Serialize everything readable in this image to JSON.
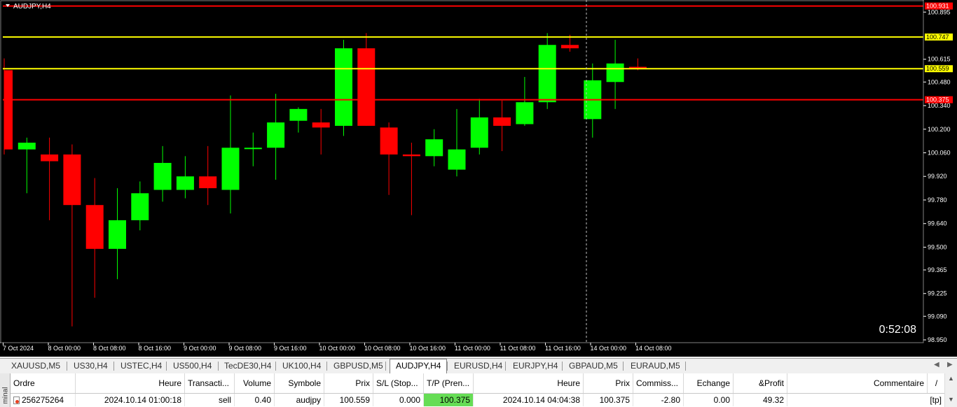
{
  "chart": {
    "title": "AUDJPY,H4",
    "timer": "0:52:08",
    "y_min": 98.95,
    "y_max": 100.95,
    "price_ticks": [
      "100.895",
      "100.615",
      "100.480",
      "100.340",
      "100.200",
      "100.060",
      "99.920",
      "99.780",
      "99.640",
      "99.500",
      "99.365",
      "99.225",
      "99.090",
      "98.950"
    ],
    "time_labels": [
      "7 Oct 2024",
      "8 Oct 00:00",
      "8 Oct 08:00",
      "8 Oct 16:00",
      "9 Oct 00:00",
      "9 Oct 08:00",
      "9 Oct 16:00",
      "10 Oct 00:00",
      "10 Oct 08:00",
      "10 Oct 16:00",
      "11 Oct 00:00",
      "11 Oct 08:00",
      "11 Oct 16:00",
      "14 Oct 00:00",
      "14 Oct 08:00"
    ],
    "hlines": [
      {
        "price": 100.931,
        "color": "#ff0000",
        "label": "100.931"
      },
      {
        "price": 100.747,
        "color": "#ffff00",
        "label": "100.747"
      },
      {
        "price": 100.559,
        "color": "#ffff00",
        "label": "100.559"
      },
      {
        "price": 100.375,
        "color": "#ff0000",
        "label": "100.375"
      }
    ],
    "bull_color": "#00ff00",
    "bear_color": "#ff0000"
  },
  "chart_data": {
    "type": "candlestick",
    "title": "AUDJPY,H4",
    "ylim": [
      98.95,
      100.95
    ],
    "candles": [
      {
        "o": 100.55,
        "h": 100.62,
        "l": 100.05,
        "c": 100.08
      },
      {
        "o": 100.08,
        "h": 100.15,
        "l": 99.82,
        "c": 100.12
      },
      {
        "o": 100.05,
        "h": 100.15,
        "l": 99.66,
        "c": 100.01
      },
      {
        "o": 100.05,
        "h": 100.11,
        "l": 99.03,
        "c": 99.75
      },
      {
        "o": 99.75,
        "h": 99.91,
        "l": 99.2,
        "c": 99.49
      },
      {
        "o": 99.49,
        "h": 99.85,
        "l": 99.31,
        "c": 99.66
      },
      {
        "o": 99.66,
        "h": 99.89,
        "l": 99.6,
        "c": 99.82
      },
      {
        "o": 99.84,
        "h": 100.1,
        "l": 99.77,
        "c": 100.0
      },
      {
        "o": 99.84,
        "h": 100.04,
        "l": 99.79,
        "c": 99.92
      },
      {
        "o": 99.92,
        "h": 100.1,
        "l": 99.75,
        "c": 99.85
      },
      {
        "o": 99.84,
        "h": 100.4,
        "l": 99.7,
        "c": 100.09
      },
      {
        "o": 100.09,
        "h": 100.18,
        "l": 99.98,
        "c": 100.09
      },
      {
        "o": 100.09,
        "h": 100.41,
        "l": 99.9,
        "c": 100.24
      },
      {
        "o": 100.25,
        "h": 100.33,
        "l": 100.18,
        "c": 100.32
      },
      {
        "o": 100.24,
        "h": 100.32,
        "l": 100.05,
        "c": 100.21
      },
      {
        "o": 100.22,
        "h": 100.73,
        "l": 100.16,
        "c": 100.68
      },
      {
        "o": 100.68,
        "h": 100.77,
        "l": 100.22,
        "c": 100.22
      },
      {
        "o": 100.21,
        "h": 100.24,
        "l": 99.81,
        "c": 100.05
      },
      {
        "o": 100.05,
        "h": 100.12,
        "l": 99.69,
        "c": 100.04
      },
      {
        "o": 100.04,
        "h": 100.2,
        "l": 99.98,
        "c": 100.14
      },
      {
        "o": 99.96,
        "h": 100.32,
        "l": 99.92,
        "c": 100.08
      },
      {
        "o": 100.09,
        "h": 100.38,
        "l": 100.05,
        "c": 100.27
      },
      {
        "o": 100.27,
        "h": 100.37,
        "l": 100.07,
        "c": 100.22
      },
      {
        "o": 100.23,
        "h": 100.51,
        "l": 100.22,
        "c": 100.36
      },
      {
        "o": 100.36,
        "h": 100.77,
        "l": 100.32,
        "c": 100.7
      },
      {
        "o": 100.7,
        "h": 100.76,
        "l": 100.66,
        "c": 100.68
      },
      {
        "o": 100.26,
        "h": 100.59,
        "l": 100.15,
        "c": 100.49
      },
      {
        "o": 100.48,
        "h": 100.73,
        "l": 100.32,
        "c": 100.59
      },
      {
        "o": 100.57,
        "h": 100.62,
        "l": 100.55,
        "c": 100.56
      }
    ]
  },
  "tabs": {
    "items": [
      "XAUUSD,M5",
      "US30,H4",
      "USTEC,H4",
      "US500,H4",
      "TecDE30,H4",
      "UK100,H4",
      "GBPUSD,M5",
      "AUDJPY,H4",
      "EURUSD,H4",
      "EURJPY,H4",
      "GBPAUD,M5",
      "EURAUD,M5"
    ],
    "active_index": 7
  },
  "terminal": {
    "side_label": "minal",
    "columns": {
      "ordre": "Ordre",
      "heure": "Heure",
      "transaction": "Transacti...",
      "volume": "Volume",
      "symbole": "Symbole",
      "prix": "Prix",
      "sl": "S/L (Stop...",
      "tp": "T/P (Pren...",
      "heure2": "Heure",
      "prix2": "Prix",
      "commission": "Commiss...",
      "echange": "Echange",
      "profit": "&Profit",
      "commentaire": "Commentaire",
      "sort_marker": "/"
    },
    "row": {
      "ordre": "256275264",
      "heure": "2024.10.14 01:00:18",
      "transaction": "sell",
      "volume": "0.40",
      "symbole": "audjpy",
      "prix": "100.559",
      "sl": "0.000",
      "tp": "100.375",
      "heure2": "2024.10.14 04:04:38",
      "prix2": "100.375",
      "commission": "-2.80",
      "echange": "0.00",
      "profit": "49.32",
      "commentaire": "[tp]"
    }
  }
}
